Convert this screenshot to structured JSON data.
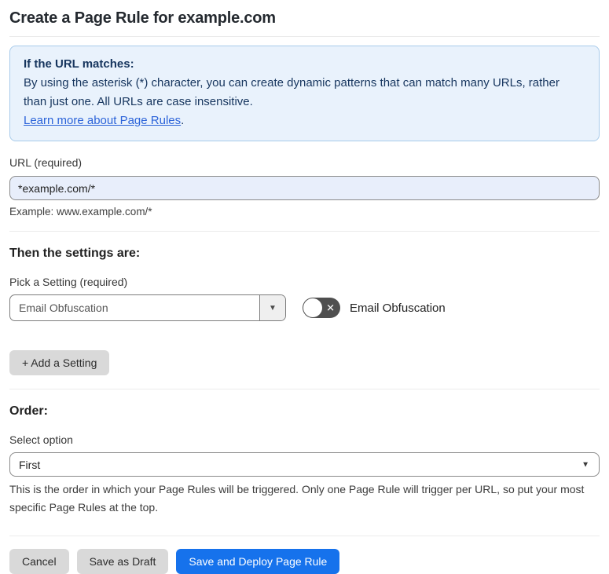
{
  "page": {
    "title": "Create a Page Rule for example.com"
  },
  "info_box": {
    "heading": "If the URL matches:",
    "body": "By using the asterisk (*) character, you can create dynamic patterns that can match many URLs, rather than just one. All URLs are case insensitive.",
    "link_label": "Learn more about Page Rules",
    "link_suffix": "."
  },
  "url_field": {
    "label": "URL (required)",
    "value": "*example.com/*",
    "helper": "Example: www.example.com/*"
  },
  "settings_section": {
    "heading": "Then the settings are:",
    "picker_label": "Pick a Setting (required)",
    "picker_value": "Email Obfuscation",
    "toggle_label": "Email Obfuscation",
    "toggle_state": "off",
    "toggle_off_glyph": "✕",
    "add_setting_label": "+ Add a Setting",
    "dropdown_arrow_glyph": "▼"
  },
  "order_section": {
    "heading": "Order:",
    "select_label": "Select option",
    "select_value": "First",
    "dropdown_arrow_glyph": "▼",
    "helper": "This is the order in which your Page Rules will be triggered. Only one Page Rule will trigger per URL, so put your most specific Page Rules at the top."
  },
  "footer": {
    "cancel_label": "Cancel",
    "save_draft_label": "Save as Draft",
    "save_deploy_label": "Save and Deploy Page Rule"
  },
  "colors": {
    "accent_blue": "#1672ec",
    "info_background": "#e9f2fc",
    "info_border": "#a8cbea",
    "info_text": "#16355e",
    "link_blue": "#2b63d9",
    "input_background": "#e8eefb",
    "toggle_off_background": "#4f4f4f",
    "button_gray": "#d9d9d9"
  }
}
